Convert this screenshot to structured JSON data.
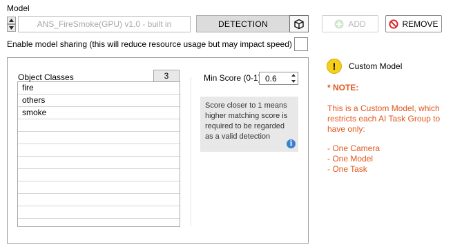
{
  "model": {
    "label": "Model",
    "selected_model": "ANS_FireSmoke(GPU) v1.0 - built in",
    "detection_button": "DETECTION",
    "add_button": "ADD",
    "remove_button": "REMOVE"
  },
  "sharing": {
    "label": "Enable model sharing (this will reduce resource usage but may impact speed)",
    "checked": false
  },
  "object_classes": {
    "label": "Object Classes",
    "count": "3",
    "items": [
      "fire",
      "others",
      "smoke",
      "",
      "",
      "",
      "",
      "",
      "",
      "",
      ""
    ]
  },
  "min_score": {
    "label": "Min Score (0-1)",
    "value": "0.6",
    "hint": "Score closer to 1 means higher matching score is required to be regarded as a valid detection"
  },
  "custom_model": {
    "label": "Custom Model",
    "note_title": "* NOTE:",
    "note_body": "This is a Custom Model, which restricts each AI Task Group to have only:",
    "restrictions": [
      "- One Camera",
      "- One Model",
      "- One Task"
    ]
  },
  "colors": {
    "note_text": "#e1561a",
    "warning_icon": "#f6cf1a",
    "remove_icon": "#d9262c",
    "info_icon": "#3b7fd1"
  },
  "icons": {
    "spin_up": "triangle-up-icon",
    "spin_down": "triangle-down-icon",
    "cube": "cube-icon",
    "add": "plus-circle-icon",
    "remove": "no-entry-icon",
    "warning": "exclamation-circle-icon",
    "info": "info-icon"
  }
}
